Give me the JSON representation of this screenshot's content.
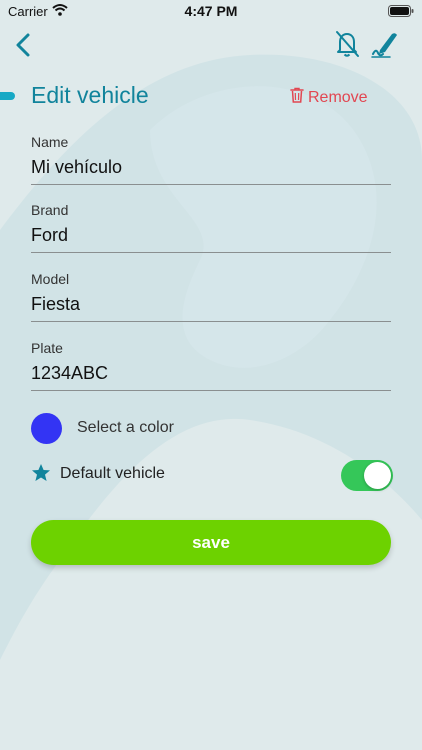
{
  "status_bar": {
    "carrier": "Carrier",
    "time": "4:47 PM",
    "icons": [
      "wifi-icon",
      "battery-icon"
    ]
  },
  "nav": {
    "icons": [
      "chevron-left-icon",
      "bell-off-icon",
      "signature-icon"
    ]
  },
  "page": {
    "title": "Edit vehicle",
    "remove_label": "Remove",
    "remove_icon": "trash-icon"
  },
  "form": {
    "name_label": "Name",
    "name_value": "Mi vehículo",
    "brand_label": "Brand",
    "brand_value": "Ford",
    "model_label": "Model",
    "model_value": "Fiesta",
    "plate_label": "Plate",
    "plate_value": "1234ABC",
    "color_label": "Select a color",
    "default_label": "Default vehicle",
    "default_on": true,
    "save_label": "save"
  },
  "colors": {
    "accent": "#11849c",
    "remove": "#e24651",
    "selected_color": "#3334f4",
    "toggle_on": "#35c759",
    "save_button": "#6dd200",
    "background": "#dfeaeb"
  }
}
